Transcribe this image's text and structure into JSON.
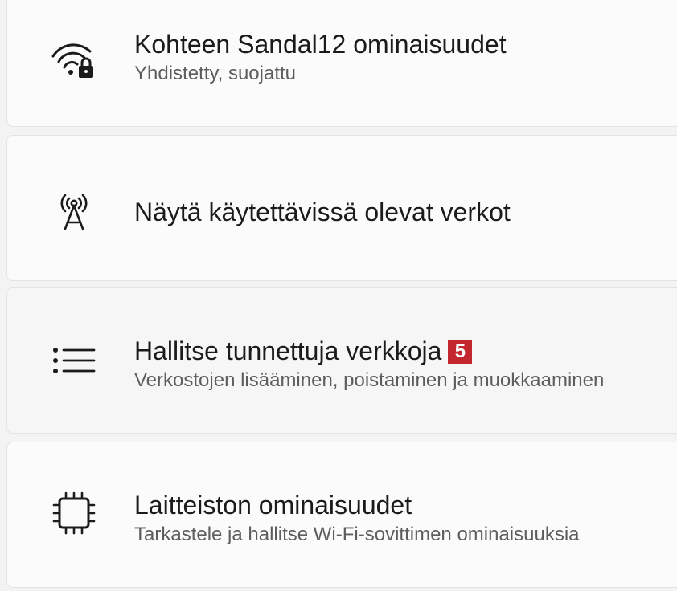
{
  "items": [
    {
      "title": "Kohteen Sandal12 ominaisuudet",
      "subtitle": "Yhdistetty, suojattu",
      "icon": "wifi-lock-icon"
    },
    {
      "title": "Näytä käytettävissä olevat verkot",
      "subtitle": "",
      "icon": "antenna-icon"
    },
    {
      "title": "Hallitse tunnettuja verkkoja",
      "subtitle": "Verkostojen lisääminen, poistaminen ja muokkaaminen",
      "icon": "list-icon",
      "badge": "5"
    },
    {
      "title": "Laitteiston ominaisuudet",
      "subtitle": "Tarkastele ja hallitse Wi-Fi-sovittimen ominaisuuksia",
      "icon": "chip-icon"
    }
  ],
  "colors": {
    "badge": "#c4262e",
    "card": "#fbfbfb",
    "background": "#f3f3f3"
  }
}
